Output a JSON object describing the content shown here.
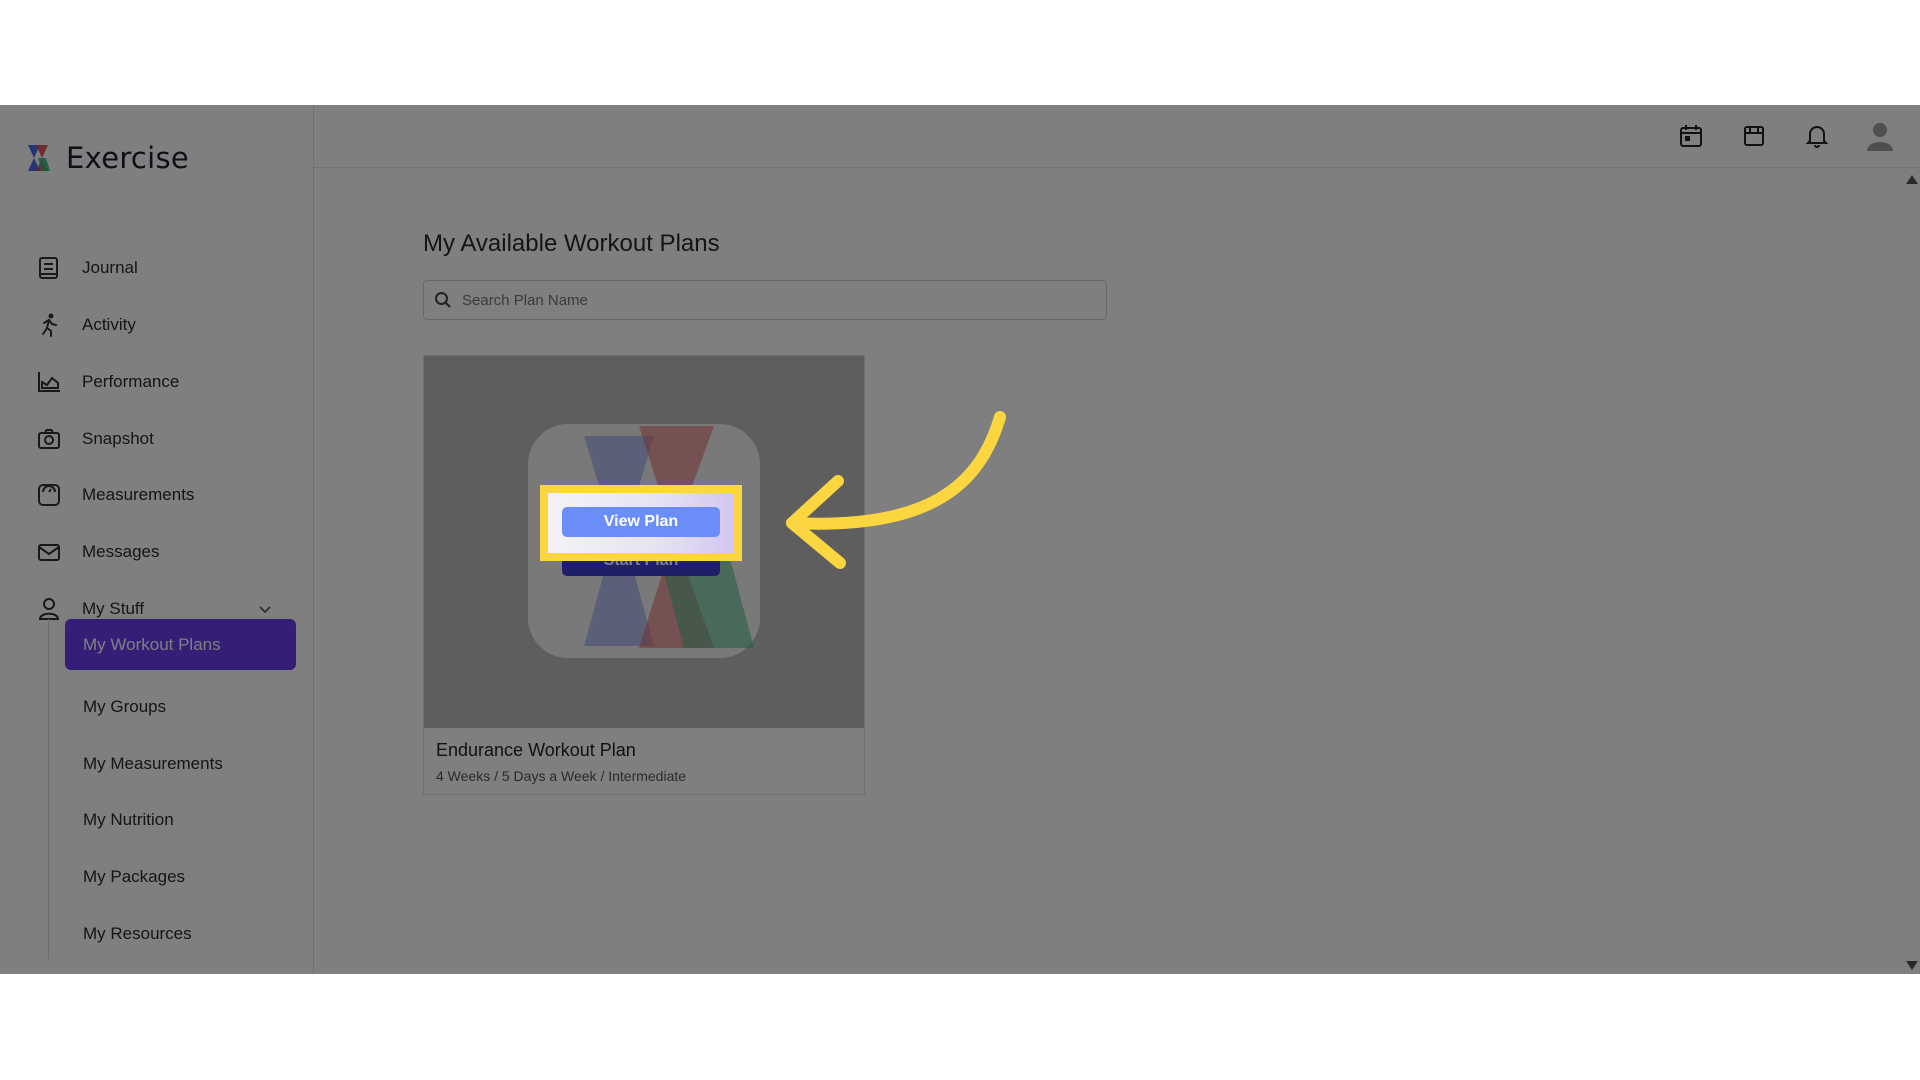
{
  "app": {
    "name": "Exercise"
  },
  "sidebar": {
    "items": [
      {
        "label": "Journal",
        "icon": "journal-icon"
      },
      {
        "label": "Activity",
        "icon": "running-person-icon"
      },
      {
        "label": "Performance",
        "icon": "area-chart-icon"
      },
      {
        "label": "Snapshot",
        "icon": "camera-icon"
      },
      {
        "label": "Measurements",
        "icon": "scale-icon"
      },
      {
        "label": "Messages",
        "icon": "envelope-icon"
      },
      {
        "label": "My Stuff",
        "icon": "user-icon"
      }
    ],
    "sub_items": [
      {
        "label": "My Workout Plans",
        "active": true
      },
      {
        "label": "My Groups"
      },
      {
        "label": "My Measurements"
      },
      {
        "label": "My Nutrition"
      },
      {
        "label": "My Packages"
      },
      {
        "label": "My Resources"
      }
    ]
  },
  "topbar": {
    "icons": [
      "calendar-icon",
      "store-icon",
      "bell-icon",
      "avatar-icon"
    ]
  },
  "main": {
    "title": "My Available Workout Plans",
    "search_placeholder": "Search Plan Name",
    "card": {
      "title": "Endurance Workout Plan",
      "subtitle": "4 Weeks / 5 Days a Week / Intermediate",
      "view_label": "View Plan",
      "start_label": "Start Plan"
    }
  },
  "colors": {
    "accent": "#6a3cf0",
    "view_button": "#6b8dfa",
    "start_button": "#3d3ed0",
    "highlight": "#fcd640",
    "overlay": "rgba(0,0,0,0.5)"
  }
}
